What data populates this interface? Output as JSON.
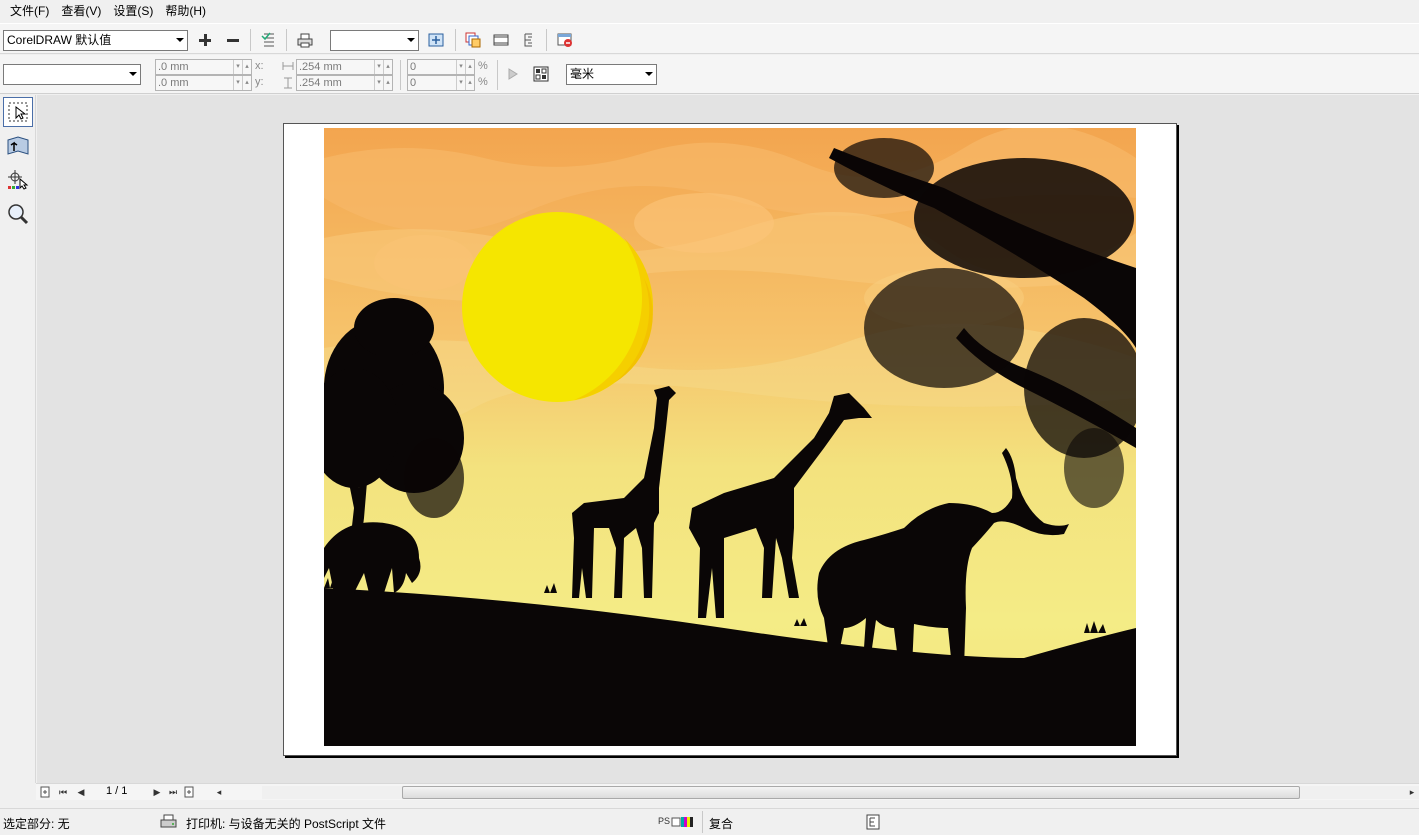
{
  "menu": {
    "items": [
      "文件(F)",
      "查看(V)",
      "设置(S)",
      "帮助(H)"
    ]
  },
  "toolbar1": {
    "preset": "CorelDRAW 默认值",
    "empty_combo": ""
  },
  "toolbar2": {
    "style_combo": "",
    "pos_x": ".0 mm",
    "pos_y": ".0 mm",
    "label_x": "x:",
    "label_y": "y:",
    "width_val": ".254 mm",
    "height_val": ".254 mm",
    "pct1": "0",
    "pct2": "0",
    "pct_sign": "%",
    "units": "毫米"
  },
  "navigation": {
    "page_indicator": "1 / 1"
  },
  "status": {
    "selection": "选定部分: 无",
    "printer": "打印机: 与设备无关的 PostScript 文件",
    "mode": "复合"
  },
  "colors": {
    "sky_top": "#f3a54f",
    "sky_bottom": "#f4ec86",
    "sun": "#f5e600",
    "silhouette": "#0a0606"
  }
}
